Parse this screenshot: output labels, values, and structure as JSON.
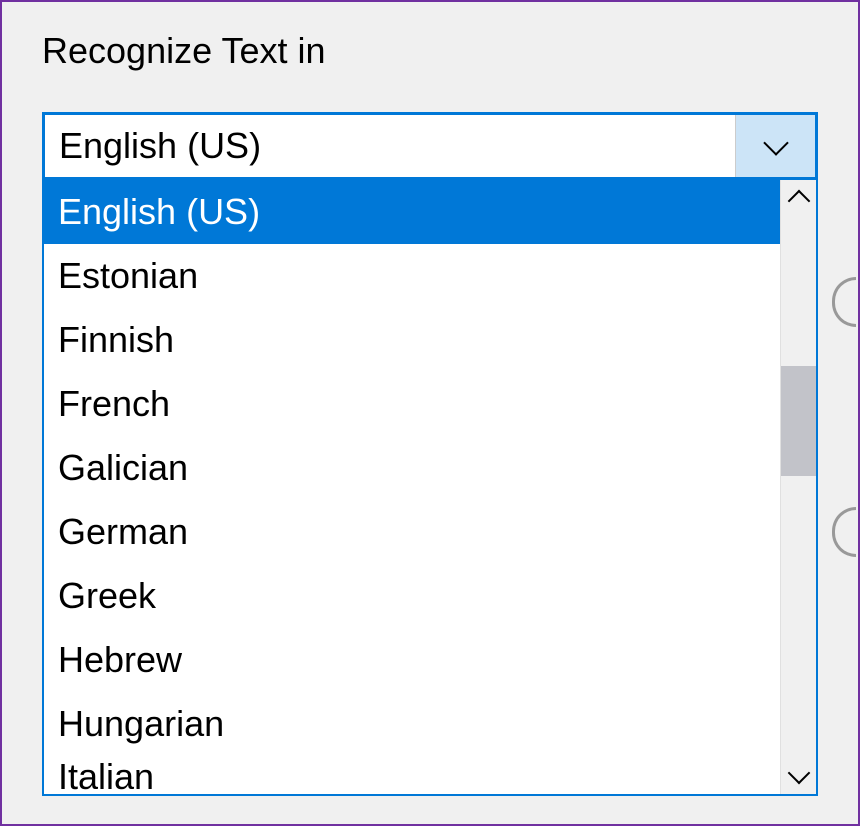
{
  "label": "Recognize Text in",
  "combo": {
    "selected_value": "English (US)"
  },
  "options": [
    "English (US)",
    "Estonian",
    "Finnish",
    "French",
    "Galician",
    "German",
    "Greek",
    "Hebrew",
    "Hungarian",
    "Italian"
  ],
  "colors": {
    "selection": "#0078d7",
    "arrow_bg": "#cce4f7",
    "border": "#7030a0"
  }
}
